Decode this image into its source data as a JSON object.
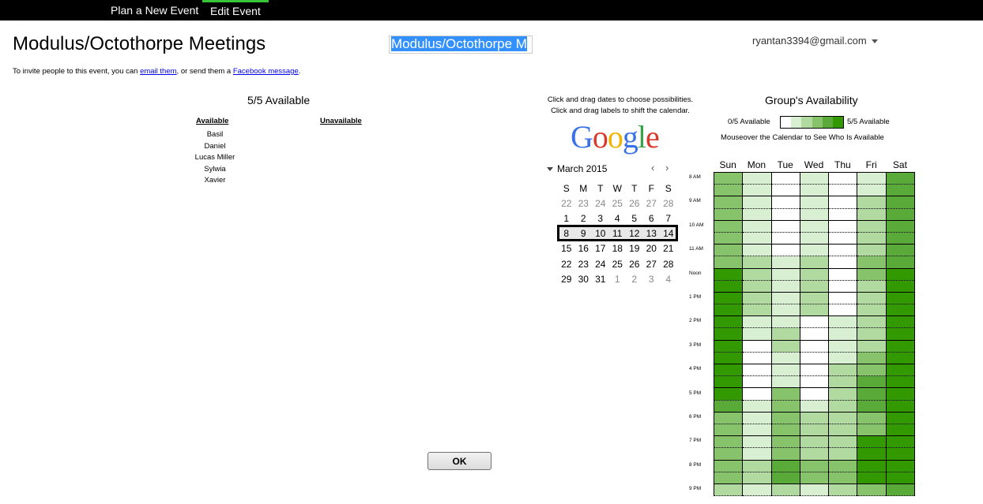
{
  "nav": {
    "tabs": [
      {
        "label": "Plan a New Event",
        "active": false
      },
      {
        "label": "Edit Event",
        "active": true
      }
    ]
  },
  "header": {
    "title": "Modulus/Octothorpe Meetings",
    "title_input_value": "Modulus/Octothorpe M",
    "account_email": "ryantan3394@gmail.com"
  },
  "invite": {
    "prefix": "To invite people to this event, you can ",
    "email_link": "email them",
    "middle": ", or send them a ",
    "facebook_link": "Facebook message",
    "suffix": "."
  },
  "availability": {
    "heading": "5/5 Available",
    "available_header": "Available",
    "unavailable_header": "Unavailable",
    "available": [
      "Basil",
      "Daniel",
      "Lucas Miller",
      "Sylwia",
      "Xavier"
    ],
    "unavailable": []
  },
  "calendar_help": {
    "line1": "Click and drag dates to choose possibilities.",
    "line2": "Click and drag labels to shift the calendar."
  },
  "mini_calendar": {
    "month_label": "March 2015",
    "prev_icon": "chevron-left-icon",
    "next_icon": "chevron-right-icon",
    "weekday_headers": [
      "S",
      "M",
      "T",
      "W",
      "T",
      "F",
      "S"
    ],
    "selected_week_index": 2,
    "weeks": [
      [
        {
          "d": "22",
          "o": true
        },
        {
          "d": "23",
          "o": true
        },
        {
          "d": "24",
          "o": true
        },
        {
          "d": "25",
          "o": true
        },
        {
          "d": "26",
          "o": true
        },
        {
          "d": "27",
          "o": true
        },
        {
          "d": "28",
          "o": true
        }
      ],
      [
        {
          "d": "1"
        },
        {
          "d": "2"
        },
        {
          "d": "3"
        },
        {
          "d": "4"
        },
        {
          "d": "5"
        },
        {
          "d": "6"
        },
        {
          "d": "7"
        }
      ],
      [
        {
          "d": "8"
        },
        {
          "d": "9"
        },
        {
          "d": "10"
        },
        {
          "d": "11"
        },
        {
          "d": "12"
        },
        {
          "d": "13"
        },
        {
          "d": "14"
        }
      ],
      [
        {
          "d": "15"
        },
        {
          "d": "16"
        },
        {
          "d": "17"
        },
        {
          "d": "18"
        },
        {
          "d": "19"
        },
        {
          "d": "20"
        },
        {
          "d": "21"
        }
      ],
      [
        {
          "d": "22"
        },
        {
          "d": "23"
        },
        {
          "d": "24"
        },
        {
          "d": "25"
        },
        {
          "d": "26"
        },
        {
          "d": "27"
        },
        {
          "d": "28"
        }
      ],
      [
        {
          "d": "29"
        },
        {
          "d": "30"
        },
        {
          "d": "31"
        },
        {
          "d": "1",
          "o": true
        },
        {
          "d": "2",
          "o": true
        },
        {
          "d": "3",
          "o": true
        },
        {
          "d": "4",
          "o": true
        }
      ]
    ]
  },
  "group": {
    "heading": "Group's Availability",
    "legend_min": "0/5 Available",
    "legend_max": "5/5 Available",
    "mouseover_hint": "Mouseover the Calendar to See Who Is Available",
    "days": [
      "Sun",
      "Mon",
      "Tue",
      "Wed",
      "Thu",
      "Fri",
      "Sat"
    ],
    "time_labels": [
      "8 AM",
      "9 AM",
      "10 AM",
      "11 AM",
      "Noon",
      "1 PM",
      "2 PM",
      "3 PM",
      "4 PM",
      "5 PM",
      "6 PM",
      "7 PM",
      "8 PM",
      "9 PM"
    ],
    "max_count": 5,
    "colors": [
      "#ffffff",
      "#d9efd1",
      "#b0da9f",
      "#86c36a",
      "#5aaa3a",
      "#339900"
    ],
    "counts_by_row": [
      [
        3,
        1,
        0,
        1,
        0,
        1,
        4
      ],
      [
        3,
        1,
        0,
        1,
        0,
        1,
        4
      ],
      [
        3,
        1,
        0,
        1,
        0,
        2,
        4
      ],
      [
        3,
        1,
        0,
        1,
        0,
        2,
        4
      ],
      [
        3,
        1,
        0,
        1,
        0,
        2,
        4
      ],
      [
        3,
        1,
        0,
        1,
        0,
        2,
        4
      ],
      [
        3,
        1,
        0,
        1,
        0,
        2,
        4
      ],
      [
        3,
        2,
        1,
        2,
        0,
        3,
        4
      ],
      [
        5,
        2,
        1,
        2,
        0,
        3,
        5
      ],
      [
        5,
        2,
        1,
        2,
        0,
        2,
        5
      ],
      [
        5,
        2,
        1,
        2,
        0,
        2,
        5
      ],
      [
        5,
        2,
        1,
        2,
        0,
        2,
        5
      ],
      [
        5,
        1,
        1,
        0,
        1,
        2,
        5
      ],
      [
        5,
        1,
        2,
        0,
        1,
        2,
        5
      ],
      [
        5,
        0,
        2,
        0,
        1,
        2,
        5
      ],
      [
        5,
        0,
        1,
        0,
        1,
        3,
        5
      ],
      [
        5,
        0,
        1,
        0,
        2,
        3,
        5
      ],
      [
        5,
        0,
        1,
        0,
        2,
        4,
        5
      ],
      [
        5,
        0,
        3,
        0,
        2,
        4,
        5
      ],
      [
        4,
        1,
        3,
        1,
        2,
        4,
        5
      ],
      [
        3,
        1,
        3,
        2,
        2,
        3,
        5
      ],
      [
        3,
        1,
        3,
        2,
        2,
        3,
        5
      ],
      [
        3,
        1,
        3,
        2,
        2,
        5,
        5
      ],
      [
        3,
        1,
        3,
        2,
        2,
        5,
        5
      ],
      [
        3,
        2,
        4,
        3,
        3,
        5,
        5
      ],
      [
        3,
        2,
        4,
        3,
        3,
        5,
        5
      ],
      [
        2,
        1,
        2,
        1,
        2,
        3,
        4
      ]
    ]
  },
  "ok_label": "OK"
}
